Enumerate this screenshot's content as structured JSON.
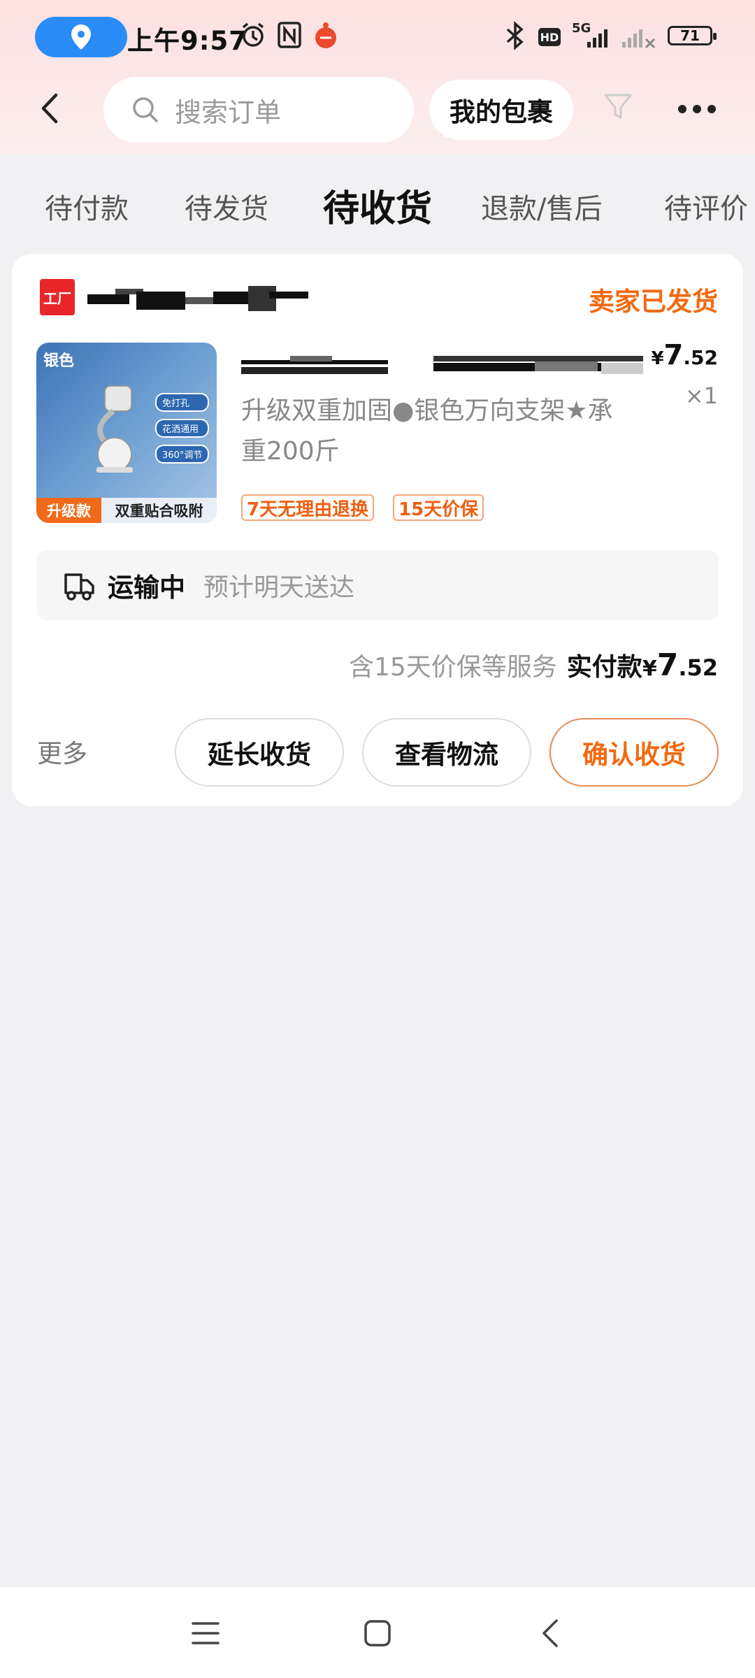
{
  "status_bar": {
    "time": "上午9:57",
    "network": "5G",
    "hd": "HD",
    "battery": "71"
  },
  "header": {
    "search_placeholder": "搜索订单",
    "my_packages": "我的包裹"
  },
  "tabs": [
    {
      "label": "待付款",
      "active": false
    },
    {
      "label": "待发货",
      "active": false
    },
    {
      "label": "待收货",
      "active": true
    },
    {
      "label": "退款/售后",
      "active": false
    },
    {
      "label": "待评价",
      "active": false
    }
  ],
  "order": {
    "shop_logo_text": "工厂",
    "status": "卖家已发货",
    "product": {
      "image_label_color": "银色",
      "image_feature_tags": [
        "免打孔",
        "花洒通用",
        "360°调节"
      ],
      "image_badge": "升级款",
      "image_caption": "双重贴合吸附",
      "description": "升级双重加固●银色万向支架★承重200斤",
      "price_symbol": "¥",
      "price_int": "7",
      "price_dec": ".52",
      "quantity": "×1",
      "tags": [
        "7天无理由退换",
        "15天价保"
      ]
    },
    "transit": {
      "label": "运输中",
      "eta": "预计明天送达"
    },
    "service_note": "含15天价保等服务",
    "paid_label": "实付款",
    "paid_symbol": "¥",
    "paid_int": "7",
    "paid_dec": ".52",
    "more": "更多",
    "buttons": {
      "extend": "延长收货",
      "logistics": "查看物流",
      "confirm": "确认收货"
    }
  },
  "colors": {
    "accent": "#f26a10",
    "location_pill": "#2a8cf6",
    "shop_logo": "#e8262a"
  }
}
